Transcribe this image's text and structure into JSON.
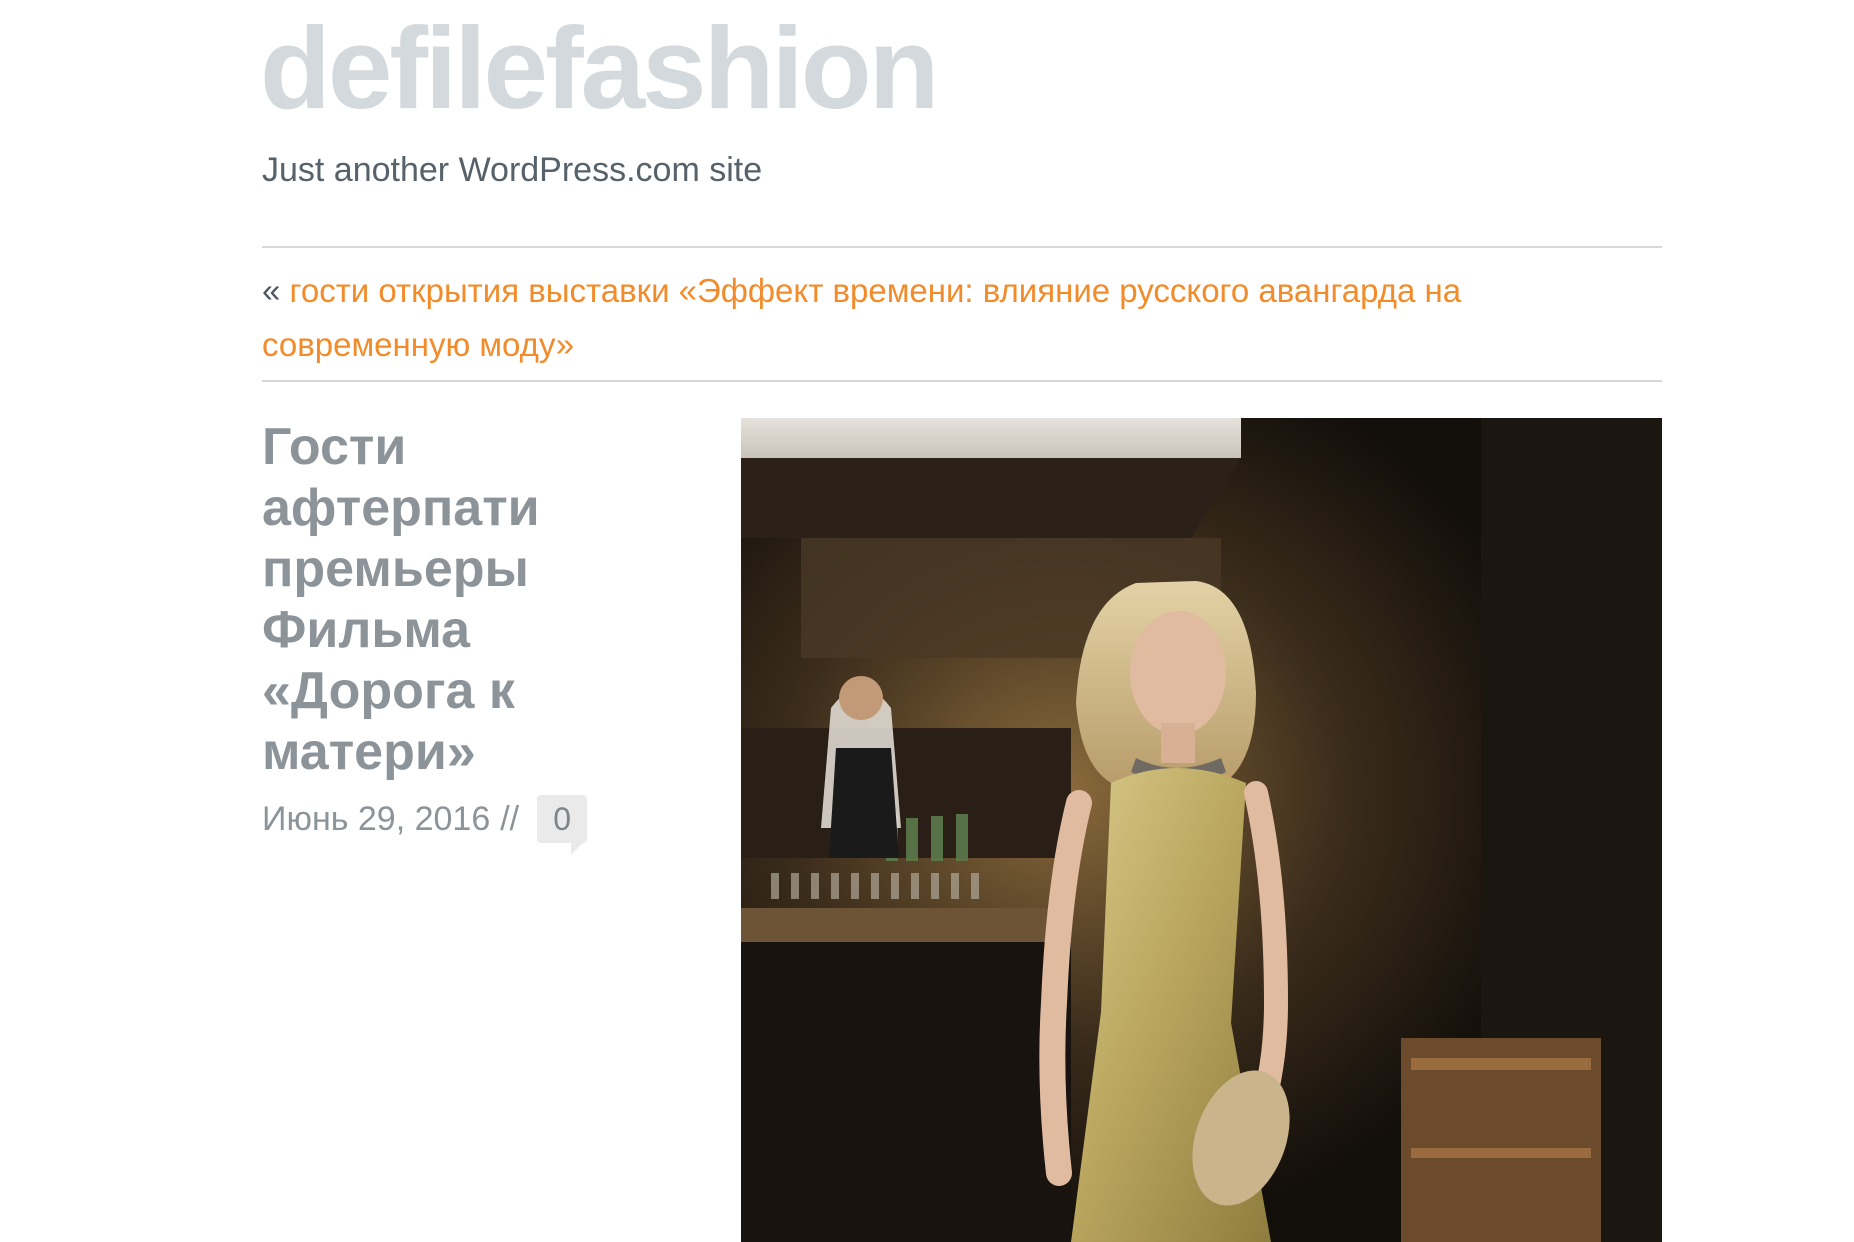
{
  "site": {
    "title": "defilefashion",
    "tagline": "Just another WordPress.com site"
  },
  "navigation": {
    "prev_arrow": "«",
    "prev_link_text": "гости открытия выставки «Эффект времени: влияние русского авангарда на современную моду»"
  },
  "post": {
    "title": "Гости афтерпати премьеры Фильма «Дорога к матери»",
    "date": "Июнь 29, 2016",
    "separator": "//",
    "comment_count": "0"
  },
  "colors": {
    "site_title": "#d3d9dd",
    "link": "#f28c2b",
    "post_title": "#8d9499",
    "text": "#56616a"
  }
}
